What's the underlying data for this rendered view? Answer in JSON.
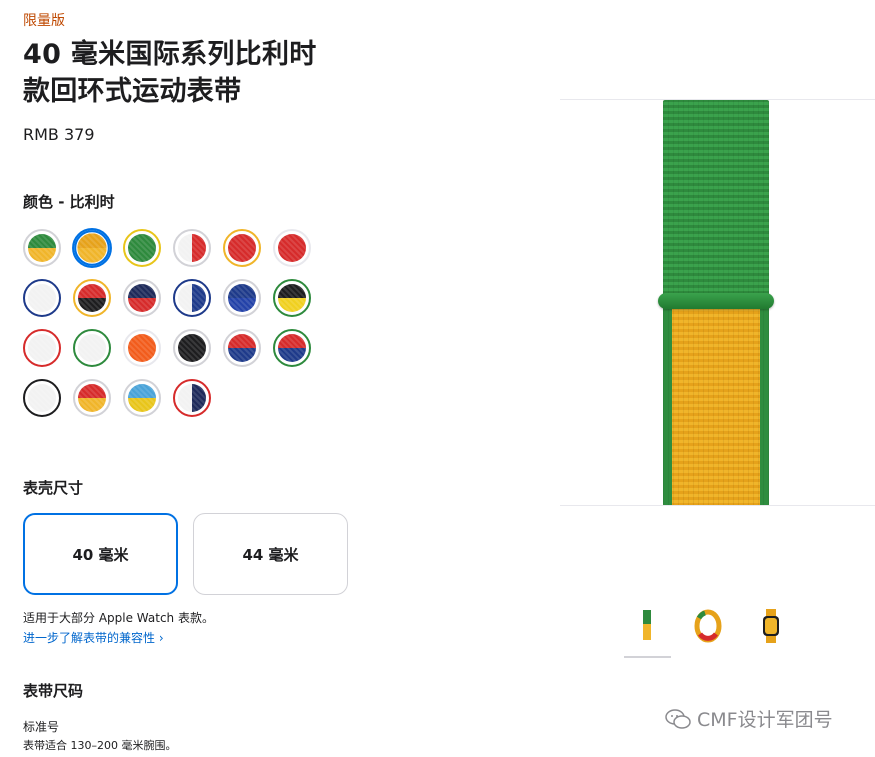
{
  "product": {
    "badge": "限量版",
    "title_line1": "40 毫米国际系列比利时",
    "title_line2": "款回环式运动表带",
    "price": "RMB 379"
  },
  "color_section": {
    "label": "颜色 - 比利时",
    "selected_index": 1,
    "swatches": [
      {
        "colors": [
          "#2e8a3d",
          "#f0b52a"
        ],
        "style": "h",
        "border": "#d2d2d7"
      },
      {
        "colors": [
          "#e6a21a",
          "#f0b52a"
        ],
        "style": "h",
        "border": "#0071e3"
      },
      {
        "colors": [
          "#2e8a3d",
          "#2e8a3d"
        ],
        "style": "h",
        "border": "#e8c51a"
      },
      {
        "colors": [
          "#f2f2f2",
          "#d62b2b"
        ],
        "style": "v",
        "border": "#d2d2d7"
      },
      {
        "colors": [
          "#d62b2b",
          "#d62b2b"
        ],
        "style": "h",
        "border": "#f0b52a"
      },
      {
        "colors": [
          "#d62b2b",
          "#d62b2b"
        ],
        "style": "h",
        "border": "#e8e8ed"
      },
      {
        "colors": [
          "#f2f2f2",
          "#f2f2f2"
        ],
        "style": "h",
        "border": "#1e3a8a"
      },
      {
        "colors": [
          "#d62b2b",
          "#1d1d1f"
        ],
        "style": "h",
        "border": "#f0b52a"
      },
      {
        "colors": [
          "#1e2a5a",
          "#d62b2b"
        ],
        "style": "h",
        "border": "#d2d2d7"
      },
      {
        "colors": [
          "#f2f2f2",
          "#1e3a8a"
        ],
        "style": "v",
        "border": "#1e3a8a"
      },
      {
        "colors": [
          "#1e3a8a",
          "#2342a8"
        ],
        "style": "h",
        "border": "#d2d2d7"
      },
      {
        "colors": [
          "#1d1d1f",
          "#f0d020"
        ],
        "style": "h",
        "border": "#2e8a3d"
      },
      {
        "colors": [
          "#f2f2f2",
          "#f2f2f2"
        ],
        "style": "h",
        "border": "#d62b2b"
      },
      {
        "colors": [
          "#f2f2f2",
          "#f2f2f2"
        ],
        "style": "h",
        "border": "#2e8a3d"
      },
      {
        "colors": [
          "#f25c1c",
          "#f25c1c"
        ],
        "style": "h",
        "border": "#e8e8ed"
      },
      {
        "colors": [
          "#1d1d1f",
          "#1d1d1f"
        ],
        "style": "h",
        "border": "#d2d2d7"
      },
      {
        "colors": [
          "#d62b2b",
          "#1e3a8a"
        ],
        "style": "h",
        "border": "#d2d2d7"
      },
      {
        "colors": [
          "#d62b2b",
          "#1e3a8a"
        ],
        "style": "h",
        "border": "#2e8a3d"
      },
      {
        "colors": [
          "#f2f2f2",
          "#f2f2f2"
        ],
        "style": "h",
        "border": "#1d1d1f"
      },
      {
        "colors": [
          "#d62b2b",
          "#f0b52a"
        ],
        "style": "h",
        "border": "#d2d2d7"
      },
      {
        "colors": [
          "#4aa3d8",
          "#e8c51a"
        ],
        "style": "h",
        "border": "#d2d2d7"
      },
      {
        "colors": [
          "#f2f2f2",
          "#1e2a5a"
        ],
        "style": "v",
        "border": "#d62b2b"
      }
    ]
  },
  "case_size": {
    "label": "表壳尺寸",
    "options": [
      "40 毫米",
      "44 毫米"
    ],
    "selected_index": 0,
    "note": "适用于大部分 Apple Watch 表款。",
    "compat_link": "进一步了解表带的兼容性 ›"
  },
  "band_size": {
    "label": "表带尺码",
    "value": "标准号",
    "detail": "表带适合 130–200 毫米腕围。"
  },
  "hero": {
    "band_upper_color": "#2e8a3d",
    "band_lower_color": "#f0b52a",
    "thumbnails": [
      "band-front-thumb",
      "band-loop-thumb",
      "watch-with-band-thumb"
    ],
    "selected_thumb": 0
  },
  "watermark": {
    "text": "CMF设计军团号"
  }
}
